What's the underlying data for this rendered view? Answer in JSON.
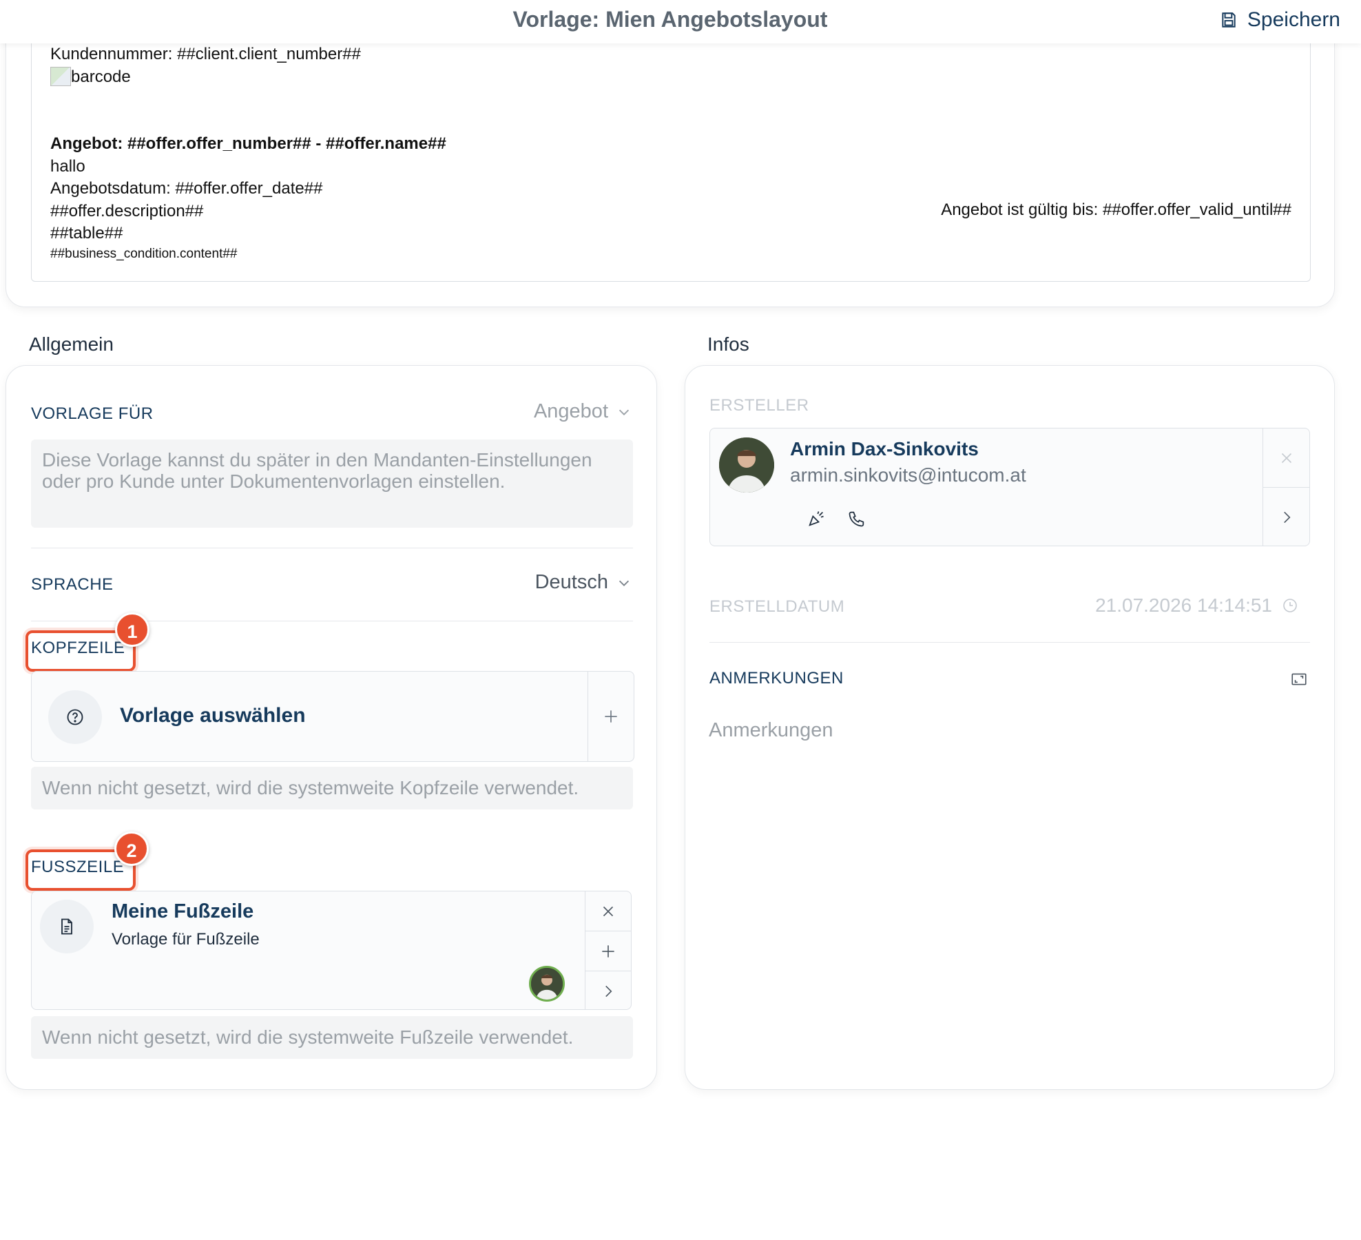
{
  "header": {
    "title": "Vorlage: Mien Angebotslayout",
    "save_label": "Speichern"
  },
  "preview": {
    "line_client": "Kundennummer: ##client.client_number##",
    "barcode_alt": "barcode",
    "offer_heading": "Angebot: ##offer.offer_number## - ##offer.name##",
    "line_hallo": "hallo",
    "line_date": "Angebotsdatum: ##offer.offer_date##",
    "line_description": "##offer.description##",
    "line_table": "##table##",
    "line_business": "##business_condition.content##",
    "valid_until": "Angebot ist gültig bis: ##offer.offer_valid_until##"
  },
  "general": {
    "heading": "Allgemein",
    "template_for_label": "VORLAGE FÜR",
    "template_for_value": "Angebot",
    "template_for_hint": "Diese Vorlage kannst du später in den Mandanten-Einstellungen oder pro Kunde unter Dokumentenvorlagen einstellen.",
    "language_label": "SPRACHE",
    "language_value": "Deutsch",
    "header_label": "KOPFZEILE",
    "header_badge": "1",
    "header_select": "Vorlage auswählen",
    "header_hint": "Wenn nicht gesetzt, wird die systemweite Kopfzeile verwendet.",
    "footer_label": "FUSSZEILE",
    "footer_badge": "2",
    "footer_title": "Meine Fußzeile",
    "footer_subtitle": "Vorlage für Fußzeile",
    "footer_hint": "Wenn nicht gesetzt, wird die systemweite Fußzeile verwendet."
  },
  "infos": {
    "heading": "Infos",
    "creator_label": "ERSTELLER",
    "creator_name": "Armin Dax-Sinkovits",
    "creator_email": "armin.sinkovits@intucom.at",
    "created_label": "ERSTELLDATUM",
    "created_value": "21.07.2026 14:14:51",
    "notes_label": "ANMERKUNGEN",
    "notes_placeholder": "Anmerkungen"
  },
  "colors": {
    "accent": "#163a5c",
    "highlight": "#e8502f",
    "muted": "#9aa0a6"
  }
}
